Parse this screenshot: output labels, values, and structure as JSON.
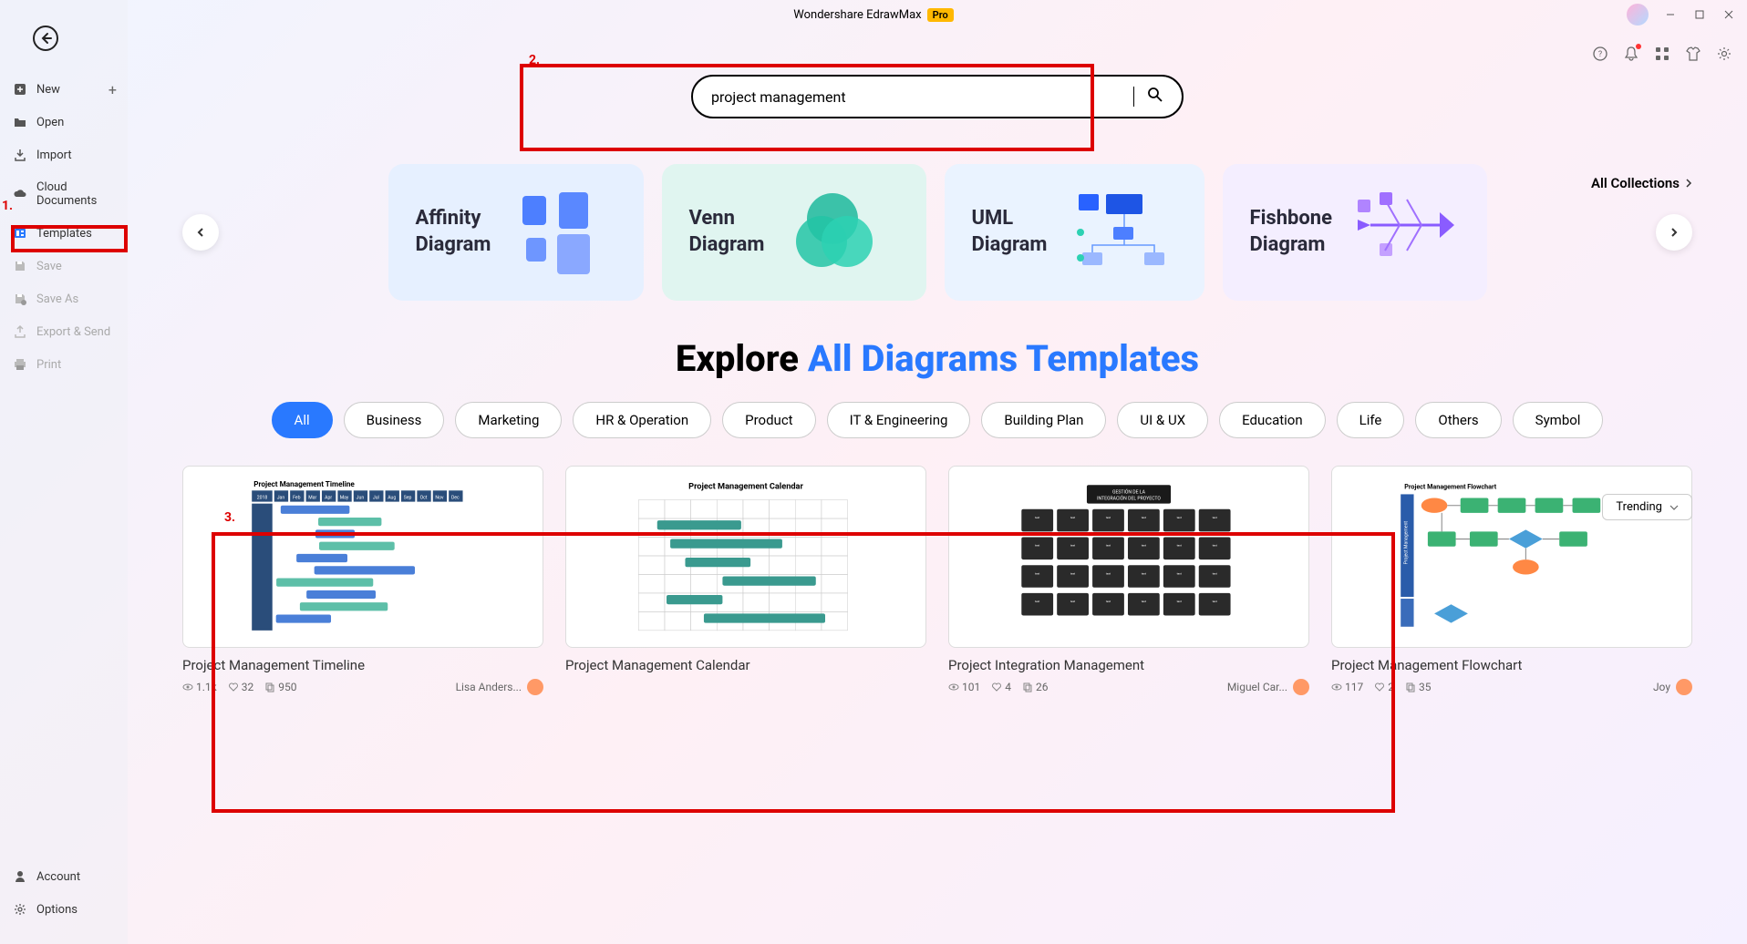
{
  "app": {
    "title": "Wondershare EdrawMax",
    "badge": "Pro"
  },
  "sidebar": {
    "items": [
      {
        "label": "New",
        "icon": "plus-square",
        "hasAdd": true
      },
      {
        "label": "Open",
        "icon": "folder"
      },
      {
        "label": "Import",
        "icon": "import"
      },
      {
        "label": "Cloud Documents",
        "icon": "cloud"
      },
      {
        "label": "Templates",
        "icon": "template",
        "active": true
      },
      {
        "label": "Save",
        "icon": "save",
        "disabled": true
      },
      {
        "label": "Save As",
        "icon": "save-as",
        "disabled": true
      },
      {
        "label": "Export & Send",
        "icon": "export",
        "disabled": true
      },
      {
        "label": "Print",
        "icon": "print",
        "disabled": true
      }
    ],
    "bottom": [
      {
        "label": "Account",
        "icon": "user"
      },
      {
        "label": "Options",
        "icon": "gear"
      }
    ]
  },
  "search": {
    "value": "project management"
  },
  "collections_link": "All Collections",
  "carousel": [
    {
      "label_l1": "Affinity",
      "label_l2": "Diagram",
      "bg": "#e6f0ff",
      "illus": "affinity"
    },
    {
      "label_l1": "Venn",
      "label_l2": "Diagram",
      "bg": "#e0f5f0",
      "illus": "venn"
    },
    {
      "label_l1": "UML",
      "label_l2": "Diagram",
      "bg": "#eaf3ff",
      "illus": "uml"
    },
    {
      "label_l1": "Fishbone",
      "label_l2": "Diagram",
      "bg": "#f4eeff",
      "illus": "fishbone"
    }
  ],
  "explore": {
    "prefix": "Explore ",
    "highlight": "All Diagrams Templates"
  },
  "pills": [
    "All",
    "Business",
    "Marketing",
    "HR & Operation",
    "Product",
    "IT & Engineering",
    "Building Plan",
    "UI & UX",
    "Education",
    "Life",
    "Others",
    "Symbol"
  ],
  "active_pill": "All",
  "sort": {
    "selected": "Trending"
  },
  "templates": [
    {
      "title": "Project Management Timeline",
      "views": "1.1k",
      "likes": "32",
      "copies": "950",
      "author": "Lisa Anders...",
      "thumb": "timeline"
    },
    {
      "title": "Project Management Calendar",
      "views": "",
      "likes": "",
      "copies": "",
      "author": "",
      "thumb": "calendar",
      "thumbTitle": "Project Management Calendar"
    },
    {
      "title": "Project Integration Management",
      "views": "101",
      "likes": "4",
      "copies": "26",
      "author": "Miguel Car...",
      "thumb": "integration",
      "thumbTitle": "GESTIÓN DE LA INTEGRACIÓN DEL PROYECTO"
    },
    {
      "title": "Project Management Flowchart",
      "views": "117",
      "likes": "2",
      "copies": "35",
      "author": "Joy",
      "thumb": "flowchart",
      "thumbTitle": "Project Management Flowchart"
    }
  ],
  "annotations": {
    "a1": "1.",
    "a2": "2.",
    "a3": "3."
  }
}
